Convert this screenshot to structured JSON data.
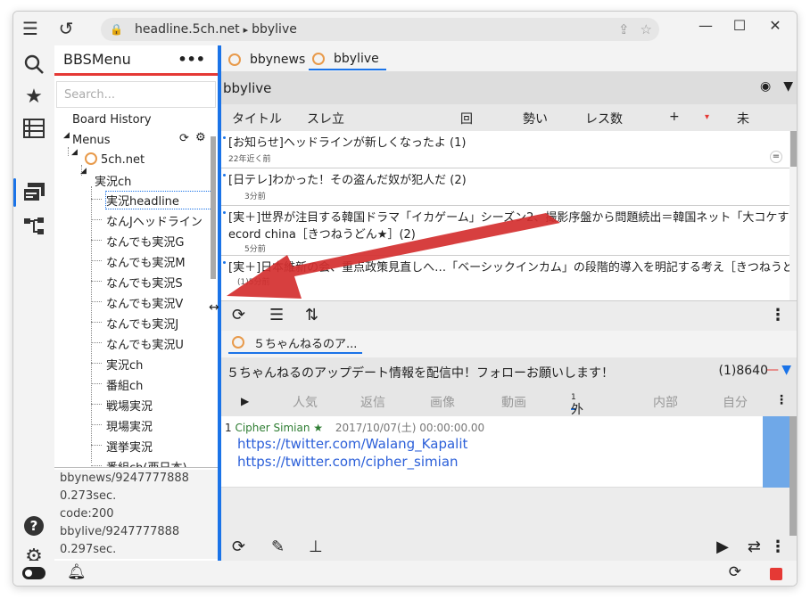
{
  "address": {
    "url": "headline.5ch.net",
    "separator": "▸",
    "board": "bbylive"
  },
  "sidebar": {
    "title": "BBSMenu",
    "more": "•••",
    "search_placeholder": "Search...",
    "board_history": "Board History",
    "menus": "Menus",
    "site": "5ch.net",
    "category": "実況ch",
    "boards": [
      "実況headline",
      "なんJヘッドライン",
      "なんでも実況G",
      "なんでも実況M",
      "なんでも実況S",
      "なんでも実況V",
      "なんでも実況J",
      "なんでも実況U",
      "実況ch",
      "番組ch",
      "戦場実況",
      "現場実況",
      "選挙実況",
      "番組ch(西日本)"
    ]
  },
  "log": [
    "bbynews/9247777888",
    "0.273sec.",
    "code:200",
    "bbylive/9247777888",
    "0.297sec."
  ],
  "tabs": [
    {
      "label": "bbynews"
    },
    {
      "label": "bbylive"
    }
  ],
  "board": {
    "name": "bbylive"
  },
  "columns": {
    "title": "タイトル",
    "created": "スレ立",
    "count": "回",
    "momentum": "勢い",
    "res": "レス数",
    "plus": "+",
    "mark": "▾",
    "unread": "未"
  },
  "threads": [
    {
      "title": "[お知らせ]ヘッドラインが新しくなったよ (1)",
      "meta": "22年近く前",
      "badge": "="
    },
    {
      "title": "[日テレ]わかった！その盗んだ奴が犯人だ (2)",
      "meta": "3分前"
    },
    {
      "title": "[実＋]世界が注目する韓国ドラマ「イカゲーム」シーズン2、撮影序盤から問題続出＝韓国ネット「大コケする」R",
      "title2": "ecord china［きつねうどん★］(2)",
      "meta": "5分前"
    },
    {
      "title": "[実＋]日本維新の会、重点政策見直しへ…「ベーシックインカム」の段階的導入を明記する考え［きつねうどん★］",
      "meta": "(1)5分前"
    }
  ],
  "thread_tab": {
    "label": "５ちゃんねるのア..."
  },
  "thread": {
    "title": "５ちゃんねるのアップデート情報を配信中！フォローお願いします！",
    "count": "(1)8640"
  },
  "filters": {
    "play": "▶",
    "popular": "人気",
    "reply": "返信",
    "image": "画像",
    "video": "動画",
    "external": "外部",
    "external_count": "1",
    "internal": "内部",
    "self": "自分"
  },
  "post": {
    "number": "1",
    "name": "Cipher Simian ★",
    "date": "2017/10/07(土) 00:00:00.00",
    "links": [
      "https://twitter.com/Walang_Kapalit",
      "https://twitter.com/cipher_simian"
    ]
  },
  "colors": {
    "accent": "#1a73e8",
    "red": "#e53935",
    "link": "#2b5fd9",
    "name": "#2e7d32"
  }
}
